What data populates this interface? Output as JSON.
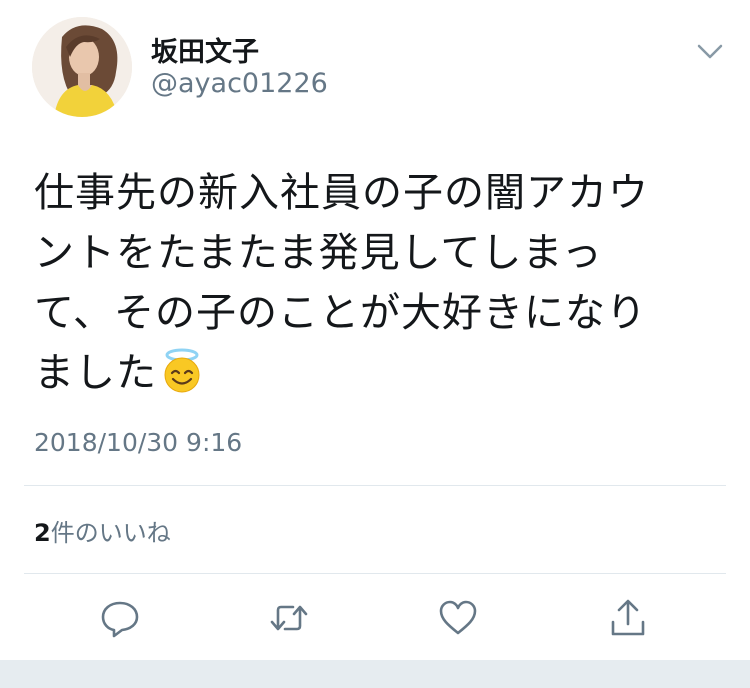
{
  "author": {
    "display_name": "坂田文子",
    "handle": "@ayac01226"
  },
  "tweet": {
    "text_lines": [
      "仕事先の新入社員の子の闇アカウ",
      "ントをたまたま発見してしまっ",
      "て、その子のことが大好きになり",
      "ました"
    ],
    "emoji": "innocent-smiling-face-with-halo",
    "timestamp": "2018/10/30 9:16"
  },
  "stats": {
    "like_count": "2",
    "like_label": "件のいいね"
  },
  "icons": {
    "menu": "chevron-down-icon",
    "reply": "reply-icon",
    "retweet": "retweet-icon",
    "like": "heart-icon",
    "share": "share-icon"
  },
  "colors": {
    "text_primary": "#14171a",
    "text_secondary": "#657786",
    "divider": "#e1e8ed",
    "icon": "#657786"
  }
}
